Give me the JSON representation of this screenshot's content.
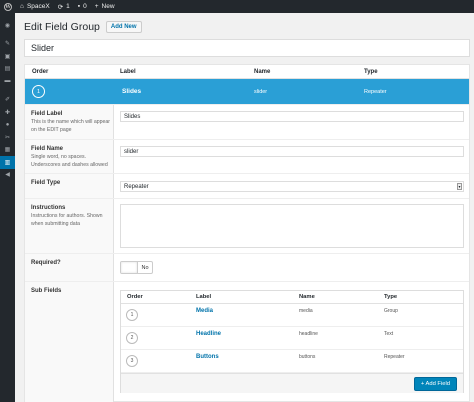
{
  "adminbar": {
    "site_name": "SpaceX",
    "updates_count": "1",
    "comments_count": "0",
    "new_label": "New"
  },
  "sidebar": {
    "icons": [
      "dashboard-icon",
      "pin-icon",
      "media-icon",
      "pages-icon",
      "comments-icon",
      "appearance-icon",
      "plugins-icon",
      "users-icon",
      "tools-icon",
      "settings-icon",
      "fields-icon",
      "collapse-icon"
    ],
    "active_index": 10
  },
  "header": {
    "title": "Edit Field Group",
    "add_new_label": "Add New"
  },
  "group_title": "Slider",
  "fields_table": {
    "columns": [
      "Order",
      "Label",
      "Name",
      "Type"
    ],
    "active_field": {
      "order": "1",
      "label": "Slides",
      "name": "slider",
      "type": "Repeater"
    }
  },
  "settings": {
    "field_label": {
      "label": "Field Label",
      "desc": "This is the name which will appear on the EDIT page",
      "value": "Slides"
    },
    "field_name": {
      "label": "Field Name",
      "desc": "Single word, no spaces. Underscores and dashes allowed",
      "value": "slider"
    },
    "field_type": {
      "label": "Field Type",
      "value": "Repeater"
    },
    "instructions": {
      "label": "Instructions",
      "desc": "Instructions for authors. Shown when submitting data"
    },
    "required": {
      "label": "Required?",
      "value": "No"
    },
    "sub_fields": {
      "label": "Sub Fields",
      "columns": [
        "Order",
        "Label",
        "Name",
        "Type"
      ],
      "rows": [
        {
          "order": "1",
          "label": "Media",
          "name": "media",
          "type": "Group"
        },
        {
          "order": "2",
          "label": "Headline",
          "name": "headline",
          "type": "Text"
        },
        {
          "order": "3",
          "label": "Buttons",
          "name": "buttons",
          "type": "Repeater"
        }
      ],
      "add_button": "+ Add Field"
    }
  },
  "colors": {
    "accent": "#0073aa",
    "active_row": "#2a9fd6",
    "adminbar": "#23282d"
  }
}
